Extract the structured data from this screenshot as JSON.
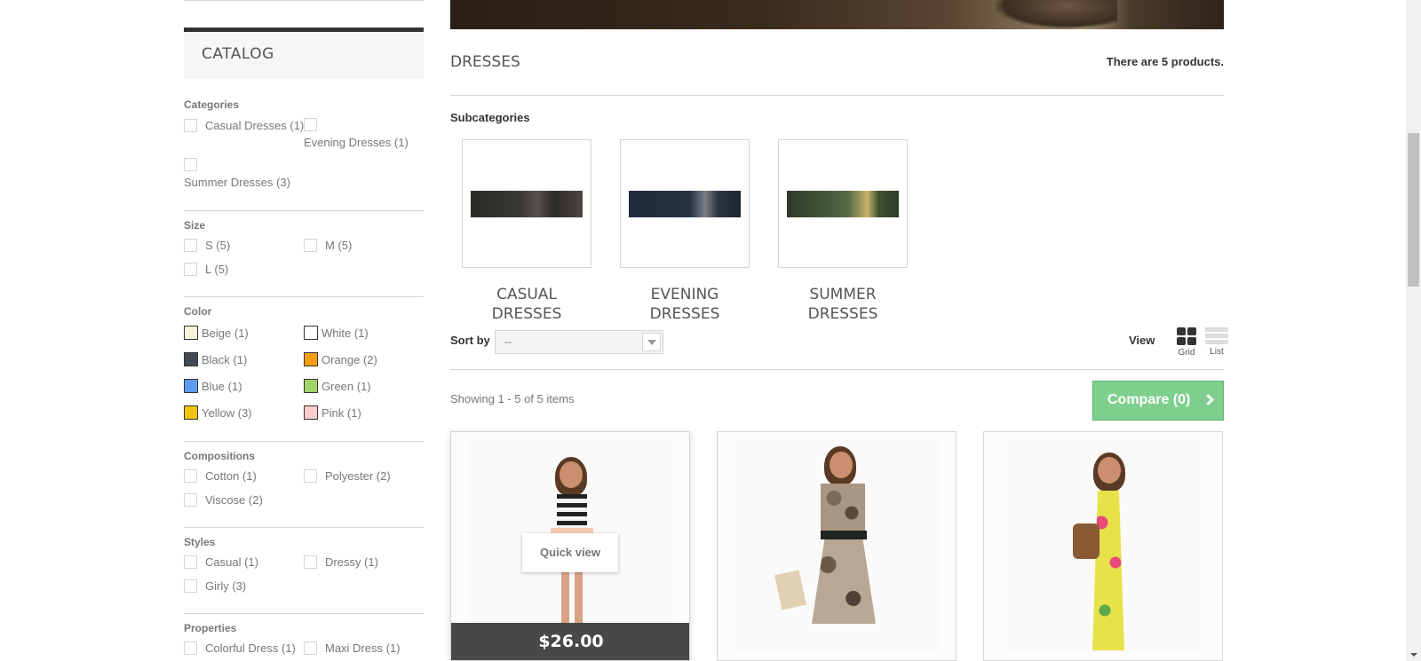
{
  "sidebar": {
    "catalog_title": "CATALOG",
    "categories": {
      "label": "Categories",
      "options": [
        "Casual Dresses (1)",
        "Evening Dresses (1)",
        "Summer Dresses (3)"
      ]
    },
    "size": {
      "label": "Size",
      "options": [
        "S (5)",
        "M (5)",
        "L (5)"
      ]
    },
    "color": {
      "label": "Color",
      "options": [
        {
          "label": "Beige (1)",
          "color": "#f5f5dc"
        },
        {
          "label": "White (1)",
          "color": "#ffffff"
        },
        {
          "label": "Black (1)",
          "color": "#434a54"
        },
        {
          "label": "Orange (2)",
          "color": "#f39c11"
        },
        {
          "label": "Blue (1)",
          "color": "#5d9cec"
        },
        {
          "label": "Green (1)",
          "color": "#a0d468"
        },
        {
          "label": "Yellow (3)",
          "color": "#f1c40f"
        },
        {
          "label": "Pink (1)",
          "color": "#fcccce"
        }
      ]
    },
    "compositions": {
      "label": "Compositions",
      "options": [
        "Cotton (1)",
        "Polyester (2)",
        "Viscose (2)"
      ]
    },
    "styles": {
      "label": "Styles",
      "options": [
        "Casual (1)",
        "Dressy (1)",
        "Girly (3)"
      ]
    },
    "properties": {
      "label": "Properties",
      "options": [
        "Colorful Dress (1)",
        "Maxi Dress (1)"
      ]
    }
  },
  "main": {
    "category_name": "DRESSES",
    "product_count": "There are 5 products.",
    "subcategories_title": "Subcategories",
    "subcategories": [
      {
        "line1": "CASUAL",
        "line2": "DRESSES"
      },
      {
        "line1": "EVENING",
        "line2": "DRESSES"
      },
      {
        "line1": "SUMMER",
        "line2": "DRESSES"
      }
    ],
    "sort_label": "Sort by",
    "sort_value": "--",
    "view_label": "View",
    "view_grid": "Grid",
    "view_list": "List",
    "showing": "Showing 1 - 5 of 5 items",
    "compare_button": "Compare (0)",
    "products": [
      {
        "quick_view": "Quick view",
        "price": "$26.00"
      }
    ]
  },
  "colors": {
    "accent_green": "#7ecf8e",
    "price_bar": "#484848",
    "border": "#d6d4d4"
  }
}
